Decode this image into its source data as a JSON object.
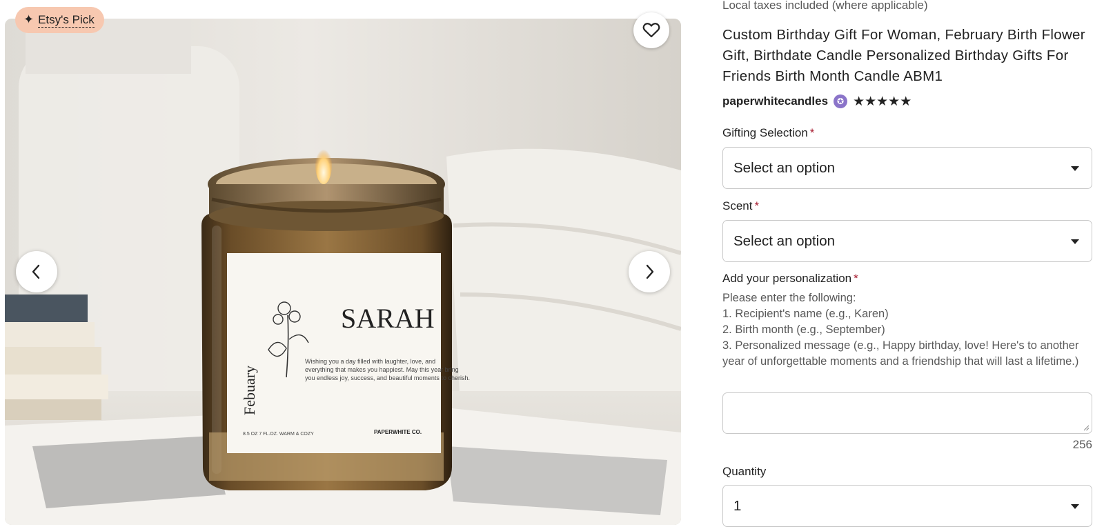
{
  "gallery": {
    "badge_label": "Etsy's Pick",
    "badge_icon": "sparkle-icon",
    "favorite_icon": "heart-icon",
    "prev_icon": "chevron-left-icon",
    "next_icon": "chevron-right-icon",
    "candle_label": {
      "name": "SARAH",
      "month": "Febuary",
      "message": "Wishing you a day filled with laughter, love, and everything that makes you happiest. May this year bring you endless joy, success, and beautiful moments to cherish.",
      "footer_left": "8.5 OZ  7 FL.OZ.  WARM & COZY",
      "brand": "PAPERWHITE CO."
    }
  },
  "listing": {
    "tax_note": "Local taxes included (where applicable)",
    "title": "Custom Birthday Gift For Woman, February Birth Flower Gift, Birthdate Candle Personalized Birthday Gifts For Friends Birth Month Candle ABM1",
    "seller": "paperwhitecandles",
    "star_seller_icon": "star-seller-badge-icon",
    "rating_stars": "★★★★★",
    "rating": 5
  },
  "form": {
    "gifting": {
      "label": "Gifting Selection",
      "required_mark": "*",
      "value": "Select an option"
    },
    "scent": {
      "label": "Scent",
      "required_mark": "*",
      "value": "Select an option"
    },
    "personalization": {
      "label": "Add your personalization",
      "required_mark": "*",
      "instructions": [
        "Please enter the following:",
        "1. Recipient's name (e.g., Karen)",
        "2. Birth month (e.g., September)",
        "3. Personalized message (e.g., Happy birthday, love! Here's to another year of unforgettable moments and a friendship that will last a lifetime.)"
      ],
      "value": "",
      "chars_remaining": "256"
    },
    "quantity": {
      "label": "Quantity",
      "value": "1"
    }
  },
  "colors": {
    "badge_bg": "#f7c8b0",
    "required_star": "#a61a2e",
    "star_seller": "#8b74c9",
    "border": "#c9c9c9"
  }
}
